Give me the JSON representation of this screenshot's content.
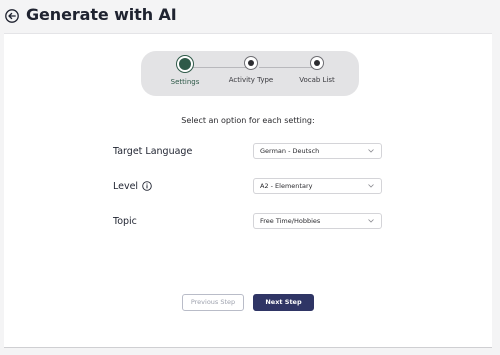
{
  "header": {
    "title": "Generate with AI",
    "back_icon": "back-arrow-circle-icon"
  },
  "stepper": {
    "steps": [
      {
        "label": "Settings",
        "state": "active"
      },
      {
        "label": "Activity Type",
        "state": "pending"
      },
      {
        "label": "Vocab List",
        "state": "pending"
      }
    ],
    "active_color": "#2f5a49"
  },
  "form": {
    "instructions": "Select an option for each setting:",
    "fields": [
      {
        "label": "Target Language",
        "value": "German - Deutsch"
      },
      {
        "label": "Level",
        "value": "A2 - Elementary",
        "icon": "info-icon"
      },
      {
        "label": "Topic",
        "value": "Free Time/Hobbies"
      }
    ]
  },
  "actions": {
    "previous_label": "Previous Step",
    "next_label": "Next Step",
    "next_color": "#2f3565"
  }
}
